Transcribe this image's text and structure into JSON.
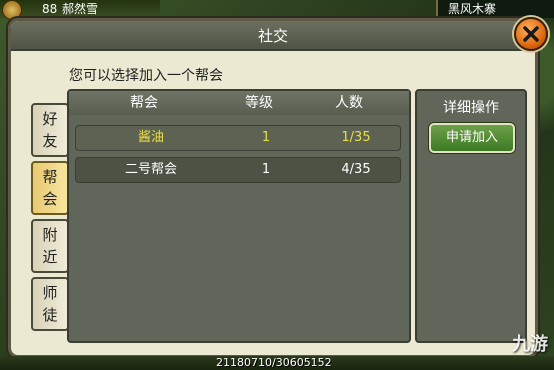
{
  "hud": {
    "level": "88",
    "player_name": "郝然雪",
    "location": "黑风木寨"
  },
  "dialog": {
    "title": "社交",
    "prompt": "您可以选择加入一个帮会",
    "tabs": [
      {
        "label": "好友",
        "active": false
      },
      {
        "label": "帮会",
        "active": true
      },
      {
        "label": "附近",
        "active": false
      },
      {
        "label": "师徒",
        "active": false
      }
    ],
    "table": {
      "headers": [
        "帮会",
        "等级",
        "人数"
      ],
      "rows": [
        {
          "name": "酱油",
          "level": "1",
          "members": "1/35",
          "selected": true
        },
        {
          "name": "二号帮会",
          "level": "1",
          "members": "4/35",
          "selected": false
        }
      ]
    },
    "detail": {
      "title": "详细操作",
      "apply_label": "申请加入"
    }
  },
  "status": {
    "coordinates": "21180710/30605152"
  },
  "watermark": "九游",
  "colors": {
    "selected_text": "#e8e040",
    "apply_button": "#4f8a30",
    "close_button": "#e06a10"
  }
}
